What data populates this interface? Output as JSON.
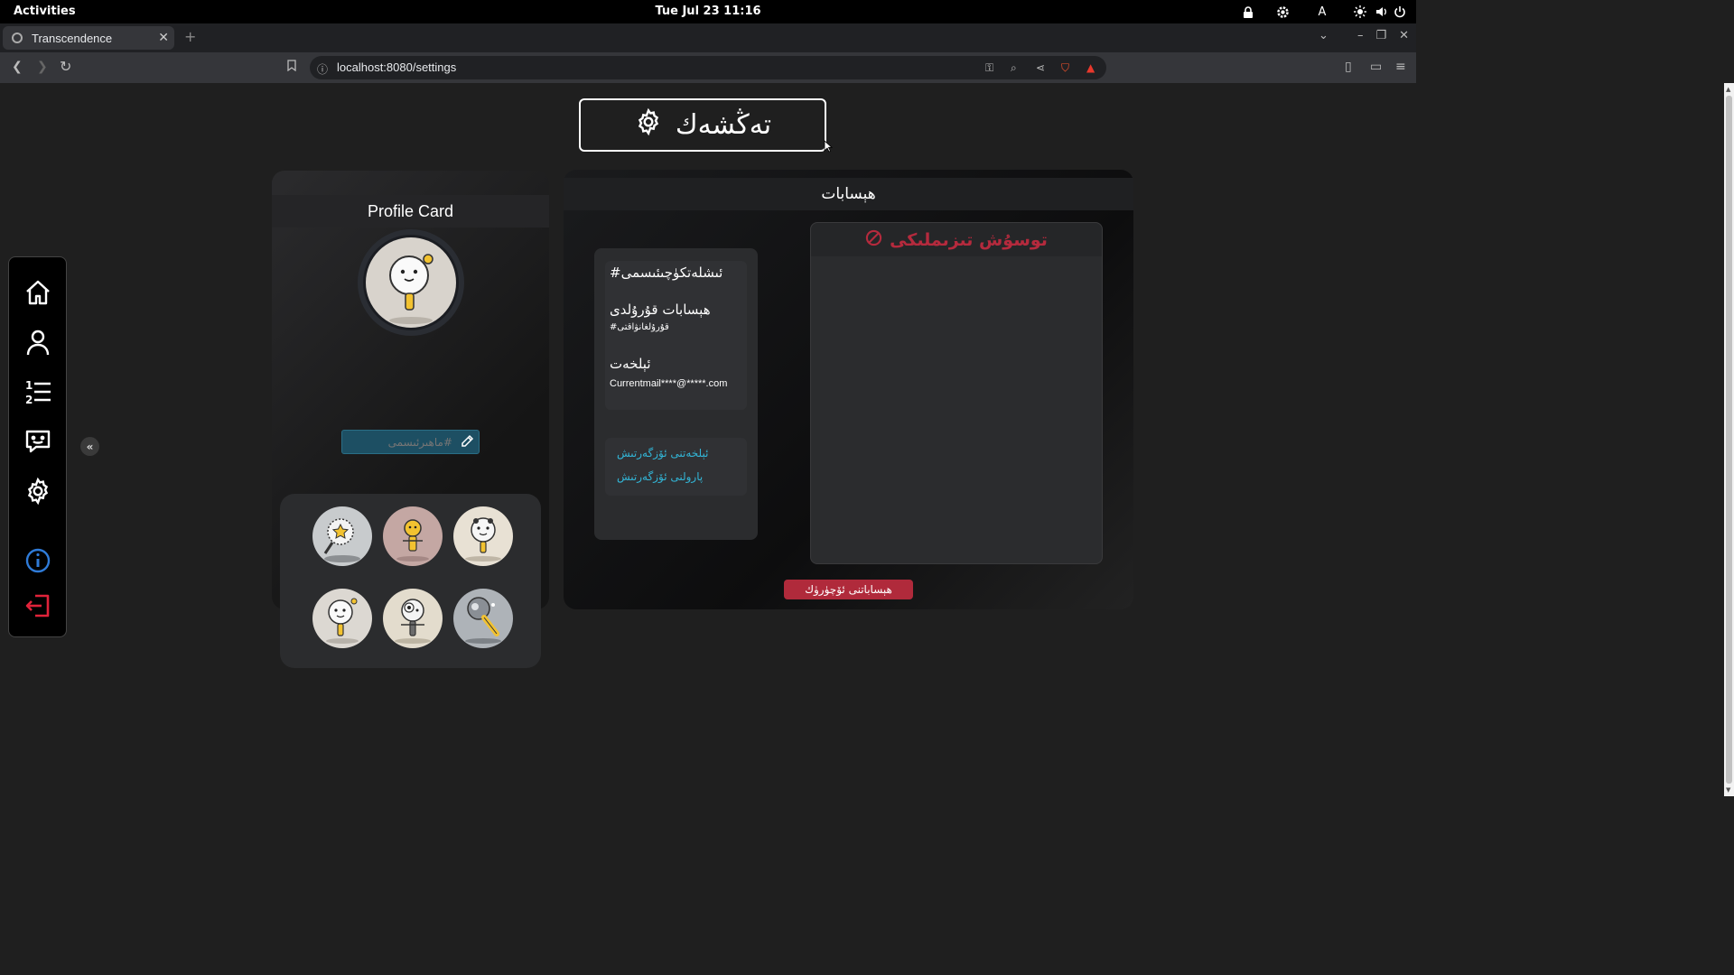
{
  "system": {
    "activities": "Activities",
    "clock": "Tue Jul 23  11:16",
    "keyboard_layout": "A"
  },
  "browser": {
    "tab_title": "Transcendence",
    "url": "localhost:8080/settings"
  },
  "page": {
    "title": "تەڭشەك"
  },
  "profile_card": {
    "heading": "Profile Card",
    "nickname_placeholder": "#ماھىرئىسمى"
  },
  "account": {
    "heading": "ھېسابات",
    "username": "#ئىشلەتكۈچىئىسمى",
    "created_label": "ھېسابات قۇرۇلدى",
    "created_value": "#قۇرۇلغانۋاقتى",
    "email_label": "ئېلخەت",
    "email_value": "Currentmail****@*****.com",
    "change_email": "ئېلخەتنى ئۆزگەرتىش",
    "change_password": "پارولنى ئۆزگەرتىش",
    "danger_title": "توسۇش تىزىملىكى",
    "delete_button": "ھېساباتنى ئۆچۈرۈك"
  },
  "colors": {
    "accent_link": "#32b5d6",
    "danger": "#b02a3b",
    "nick_input_bg": "#1d4f63"
  },
  "icons": {
    "nav": [
      "home-icon",
      "user-icon",
      "leaderboard-icon",
      "chat-icon",
      "gear-icon",
      "info-icon",
      "logout-icon"
    ]
  }
}
